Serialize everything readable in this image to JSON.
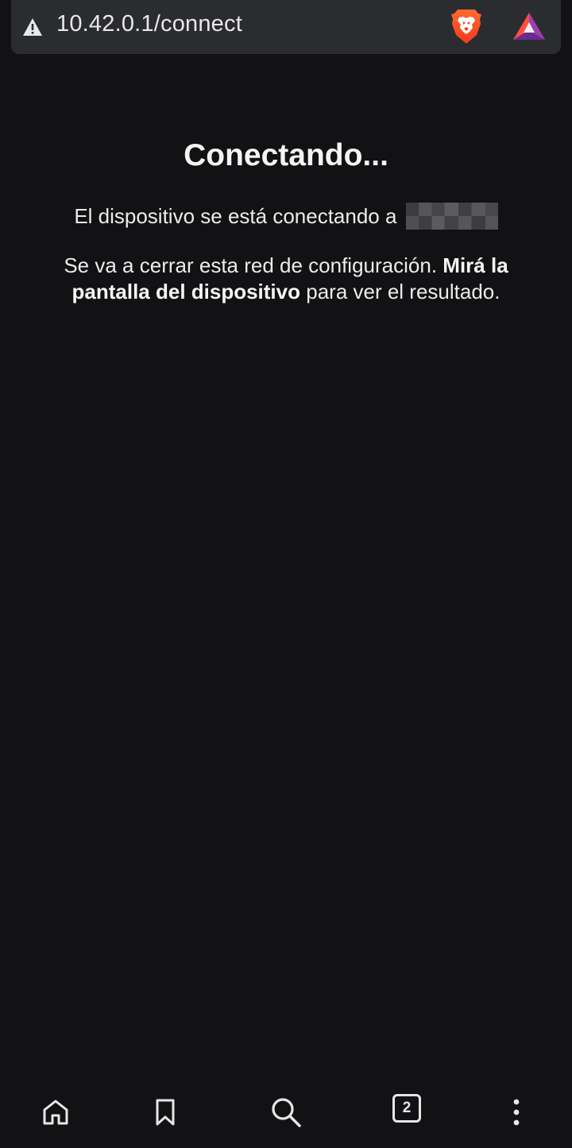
{
  "address_bar": {
    "url": "10.42.0.1/connect",
    "security_icon": "warning-triangle-icon",
    "shield_icon": "brave-shields-icon",
    "rewards_icon": "brave-rewards-icon"
  },
  "page": {
    "title": "Conectando...",
    "connecting_text": "El dispositivo se está conectando a",
    "network_name_redacted": true,
    "closing_text_start": "Se va a cerrar esta red de configuración.",
    "closing_text_bold": "Mirá la pantalla del dispositivo",
    "closing_text_end": "para ver el resultado."
  },
  "bottom_nav": {
    "home_icon": "home-icon",
    "bookmark_icon": "bookmark-icon",
    "search_icon": "search-icon",
    "tab_count": "2",
    "menu_icon": "more-vertical-icon"
  },
  "colors": {
    "background": "#121214",
    "address_bar": "#2b2c30",
    "text": "#ececec",
    "brave_orange": "#fb542b",
    "bat_purple": "#662d91"
  }
}
